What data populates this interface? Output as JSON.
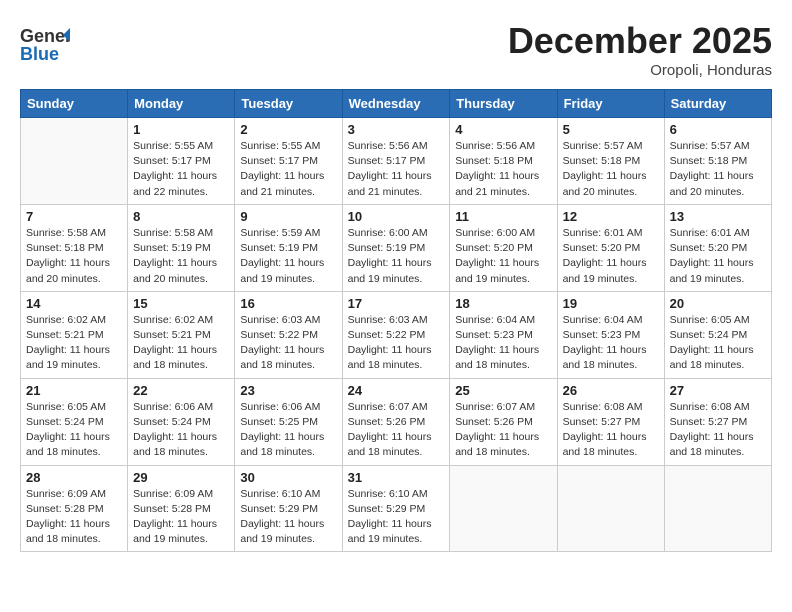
{
  "logo": {
    "line1": "General",
    "line2": "Blue"
  },
  "title": "December 2025",
  "location": "Oropoli, Honduras",
  "days_header": [
    "Sunday",
    "Monday",
    "Tuesday",
    "Wednesday",
    "Thursday",
    "Friday",
    "Saturday"
  ],
  "weeks": [
    [
      {
        "day": "",
        "info": ""
      },
      {
        "day": "1",
        "info": "Sunrise: 5:55 AM\nSunset: 5:17 PM\nDaylight: 11 hours\nand 22 minutes."
      },
      {
        "day": "2",
        "info": "Sunrise: 5:55 AM\nSunset: 5:17 PM\nDaylight: 11 hours\nand 21 minutes."
      },
      {
        "day": "3",
        "info": "Sunrise: 5:56 AM\nSunset: 5:17 PM\nDaylight: 11 hours\nand 21 minutes."
      },
      {
        "day": "4",
        "info": "Sunrise: 5:56 AM\nSunset: 5:18 PM\nDaylight: 11 hours\nand 21 minutes."
      },
      {
        "day": "5",
        "info": "Sunrise: 5:57 AM\nSunset: 5:18 PM\nDaylight: 11 hours\nand 20 minutes."
      },
      {
        "day": "6",
        "info": "Sunrise: 5:57 AM\nSunset: 5:18 PM\nDaylight: 11 hours\nand 20 minutes."
      }
    ],
    [
      {
        "day": "7",
        "info": ""
      },
      {
        "day": "8",
        "info": "Sunrise: 5:58 AM\nSunset: 5:19 PM\nDaylight: 11 hours\nand 20 minutes."
      },
      {
        "day": "9",
        "info": "Sunrise: 5:59 AM\nSunset: 5:19 PM\nDaylight: 11 hours\nand 19 minutes."
      },
      {
        "day": "10",
        "info": "Sunrise: 6:00 AM\nSunset: 5:19 PM\nDaylight: 11 hours\nand 19 minutes."
      },
      {
        "day": "11",
        "info": "Sunrise: 6:00 AM\nSunset: 5:20 PM\nDaylight: 11 hours\nand 19 minutes."
      },
      {
        "day": "12",
        "info": "Sunrise: 6:01 AM\nSunset: 5:20 PM\nDaylight: 11 hours\nand 19 minutes."
      },
      {
        "day": "13",
        "info": "Sunrise: 6:01 AM\nSunset: 5:20 PM\nDaylight: 11 hours\nand 19 minutes."
      }
    ],
    [
      {
        "day": "14",
        "info": ""
      },
      {
        "day": "15",
        "info": "Sunrise: 6:02 AM\nSunset: 5:21 PM\nDaylight: 11 hours\nand 18 minutes."
      },
      {
        "day": "16",
        "info": "Sunrise: 6:03 AM\nSunset: 5:22 PM\nDaylight: 11 hours\nand 18 minutes."
      },
      {
        "day": "17",
        "info": "Sunrise: 6:03 AM\nSunset: 5:22 PM\nDaylight: 11 hours\nand 18 minutes."
      },
      {
        "day": "18",
        "info": "Sunrise: 6:04 AM\nSunset: 5:23 PM\nDaylight: 11 hours\nand 18 minutes."
      },
      {
        "day": "19",
        "info": "Sunrise: 6:04 AM\nSunset: 5:23 PM\nDaylight: 11 hours\nand 18 minutes."
      },
      {
        "day": "20",
        "info": "Sunrise: 6:05 AM\nSunset: 5:24 PM\nDaylight: 11 hours\nand 18 minutes."
      }
    ],
    [
      {
        "day": "21",
        "info": "Sunrise: 6:05 AM\nSunset: 5:24 PM\nDaylight: 11 hours\nand 18 minutes."
      },
      {
        "day": "22",
        "info": "Sunrise: 6:06 AM\nSunset: 5:24 PM\nDaylight: 11 hours\nand 18 minutes."
      },
      {
        "day": "23",
        "info": "Sunrise: 6:06 AM\nSunset: 5:25 PM\nDaylight: 11 hours\nand 18 minutes."
      },
      {
        "day": "24",
        "info": "Sunrise: 6:07 AM\nSunset: 5:26 PM\nDaylight: 11 hours\nand 18 minutes."
      },
      {
        "day": "25",
        "info": "Sunrise: 6:07 AM\nSunset: 5:26 PM\nDaylight: 11 hours\nand 18 minutes."
      },
      {
        "day": "26",
        "info": "Sunrise: 6:08 AM\nSunset: 5:27 PM\nDaylight: 11 hours\nand 18 minutes."
      },
      {
        "day": "27",
        "info": "Sunrise: 6:08 AM\nSunset: 5:27 PM\nDaylight: 11 hours\nand 18 minutes."
      }
    ],
    [
      {
        "day": "28",
        "info": "Sunrise: 6:09 AM\nSunset: 5:28 PM\nDaylight: 11 hours\nand 18 minutes."
      },
      {
        "day": "29",
        "info": "Sunrise: 6:09 AM\nSunset: 5:28 PM\nDaylight: 11 hours\nand 19 minutes."
      },
      {
        "day": "30",
        "info": "Sunrise: 6:10 AM\nSunset: 5:29 PM\nDaylight: 11 hours\nand 19 minutes."
      },
      {
        "day": "31",
        "info": "Sunrise: 6:10 AM\nSunset: 5:29 PM\nDaylight: 11 hours\nand 19 minutes."
      },
      {
        "day": "",
        "info": ""
      },
      {
        "day": "",
        "info": ""
      },
      {
        "day": "",
        "info": ""
      }
    ]
  ],
  "week7_info": "Sunrise: 5:58 AM\nSunset: 5:18 PM\nDaylight: 11 hours\nand 20 minutes.",
  "week14_info": "Sunrise: 6:02 AM\nSunset: 5:21 PM\nDaylight: 11 hours\nand 19 minutes."
}
